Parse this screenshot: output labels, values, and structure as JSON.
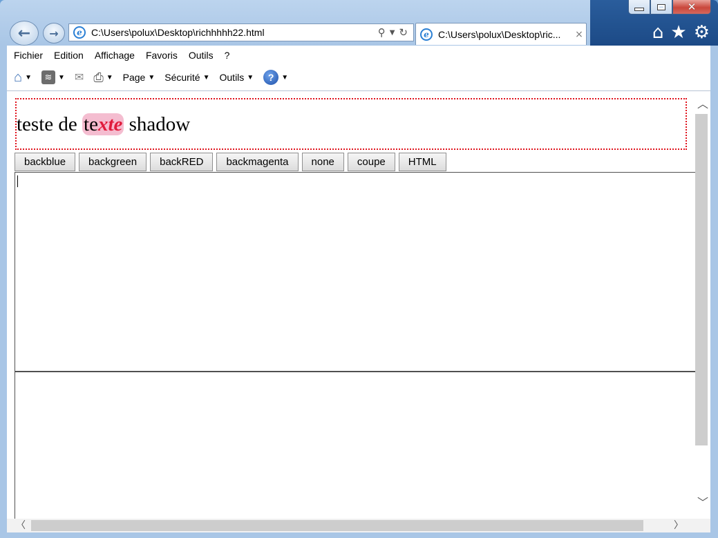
{
  "window": {
    "minimize_label": "minimize",
    "maximize_label": "maximize",
    "close_label": "close"
  },
  "address_bar": {
    "url": "C:\\Users\\polux\\Desktop\\richhhhh22.html"
  },
  "tab": {
    "title": "C:\\Users\\polux\\Desktop\\ric...",
    "close_glyph": "×"
  },
  "menu": {
    "items": [
      "Fichier",
      "Edition",
      "Affichage",
      "Favoris",
      "Outils",
      "?"
    ]
  },
  "command_bar": {
    "page_label": "Page",
    "security_label": "Sécurité",
    "tools_label": "Outils"
  },
  "content": {
    "text_before": "teste de ",
    "text_shadow_plain": "te",
    "text_shadow_styled": "xte",
    "text_after": " shadow",
    "buttons": [
      "backblue",
      "backgreen",
      "backRED",
      "backmagenta",
      "none",
      "coupe",
      "HTML"
    ]
  },
  "colors": {
    "dotted_border": "#e0121c",
    "styled_text": "#e01b3c",
    "highlight": "#f4bdd0"
  },
  "icons": {
    "back": "back-arrow-icon",
    "forward": "forward-arrow-icon",
    "home": "home-icon",
    "favorites": "star-icon",
    "settings": "gear-icon"
  }
}
